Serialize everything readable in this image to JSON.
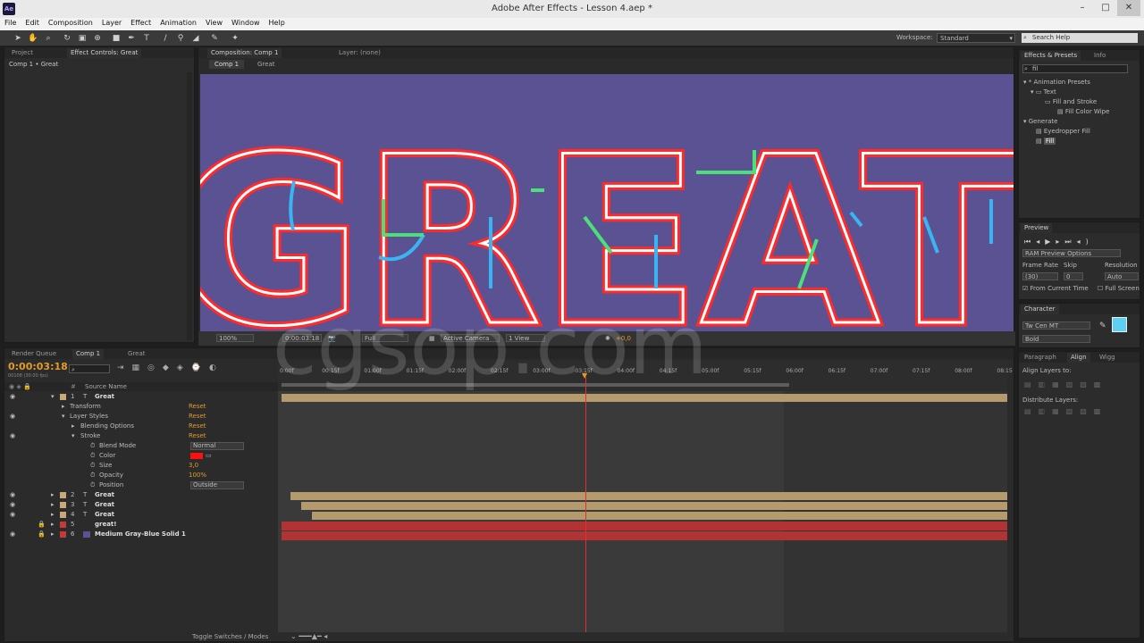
{
  "window": {
    "title": "Adobe After Effects - Lesson 4.aep *",
    "app_icon": "Ae"
  },
  "menu": [
    "File",
    "Edit",
    "Composition",
    "Layer",
    "Effect",
    "Animation",
    "View",
    "Window",
    "Help"
  ],
  "toolbar": {
    "workspace_label": "Workspace:",
    "workspace_value": "Standard",
    "search_placeholder": "Search Help"
  },
  "left_panel": {
    "tab_project": "Project",
    "tab_effect_controls": "Effect Controls: Great",
    "breadcrumb": "Comp 1 • Great"
  },
  "comp_viewer": {
    "tab_composition": "Composition: Comp 1",
    "tab_layer": "Layer: (none)",
    "crumb_comp": "Comp 1",
    "crumb_layer": "Great",
    "canvas_text": "GREAT",
    "zoom": "100%",
    "timecode": "0:00:03:18",
    "resolution": "Full",
    "camera": "Active Camera",
    "views": "1 View",
    "exposure": "+0,0",
    "bg_color": "#5b5293"
  },
  "effects_presets": {
    "tab_effects": "Effects & Presets",
    "tab_info": "Info",
    "search_value": "fil",
    "tree": [
      {
        "label": "* Animation Presets",
        "indent": 0
      },
      {
        "label": "Text",
        "indent": 1
      },
      {
        "label": "Fill and Stroke",
        "indent": 2
      },
      {
        "label": "Fill Color Wipe",
        "indent": 3
      },
      {
        "label": "Generate",
        "indent": 0
      },
      {
        "label": "Eyedropper Fill",
        "indent": 1
      },
      {
        "label": "Fill",
        "indent": 1
      }
    ]
  },
  "preview": {
    "tab": "Preview",
    "ram_options": "RAM Preview Options",
    "frame_rate_label": "Frame Rate",
    "skip_label": "Skip",
    "resolution_label": "Resolution",
    "frame_rate_value": "(30)",
    "skip_value": "0",
    "resolution_value": "Auto",
    "from_current_time": "From Current Time",
    "full_screen": "Full Screen"
  },
  "character": {
    "tab": "Character",
    "font": "Tw Cen MT",
    "style": "Bold",
    "fill_color": "#5ed1f2"
  },
  "align": {
    "tab_paragraph": "Paragraph",
    "tab_align": "Align",
    "tab_wiggler": "Wigg",
    "align_layers_to": "Align Layers to:",
    "distribute_layers": "Distribute Layers:"
  },
  "timeline": {
    "tab_render_queue": "Render Queue",
    "tab_comp1": "Comp 1",
    "tab_great": "Great",
    "timecode": "0:00:03:18",
    "timecode_sub": "00108 (30.00 fps)",
    "col_source_name": "Source Name",
    "ruler": [
      "0:00f",
      "00:15f",
      "01:00f",
      "01:15f",
      "02:00f",
      "02:15f",
      "03:00f",
      "03:15f",
      "04:00f",
      "04:15f",
      "05:00f",
      "05:15f",
      "06:00f",
      "06:15f",
      "07:00f",
      "07:15f",
      "08:00f",
      "08:15"
    ],
    "playhead_fraction": 0.43,
    "work_area_end_fraction": 0.73,
    "layers": [
      {
        "num": "1",
        "name": "Great",
        "color": "#c8a878"
      },
      {
        "num": "2",
        "name": "Great",
        "color": "#c8a878"
      },
      {
        "num": "3",
        "name": "Great",
        "color": "#c8a878"
      },
      {
        "num": "4",
        "name": "Great",
        "color": "#c8a878"
      },
      {
        "num": "5",
        "name": "great!",
        "color": "#c23a3a"
      },
      {
        "num": "6",
        "name": "Medium Gray-Blue Solid 1",
        "color": "#c23a3a"
      }
    ],
    "props": [
      {
        "name": "Transform",
        "value": "Reset"
      },
      {
        "name": "Layer Styles",
        "value": "Reset"
      },
      {
        "name": "Blending Options",
        "value": "Reset"
      },
      {
        "name": "Stroke",
        "value": "Reset"
      },
      {
        "name": "Blend Mode",
        "value": "Normal"
      },
      {
        "name": "Color",
        "value": ""
      },
      {
        "name": "Size",
        "value": "3,0"
      },
      {
        "name": "Opacity",
        "value": "100%"
      },
      {
        "name": "Position",
        "value": "Outside"
      }
    ],
    "toggle_label": "Toggle Switches / Modes"
  },
  "watermark": "cgsop.com"
}
